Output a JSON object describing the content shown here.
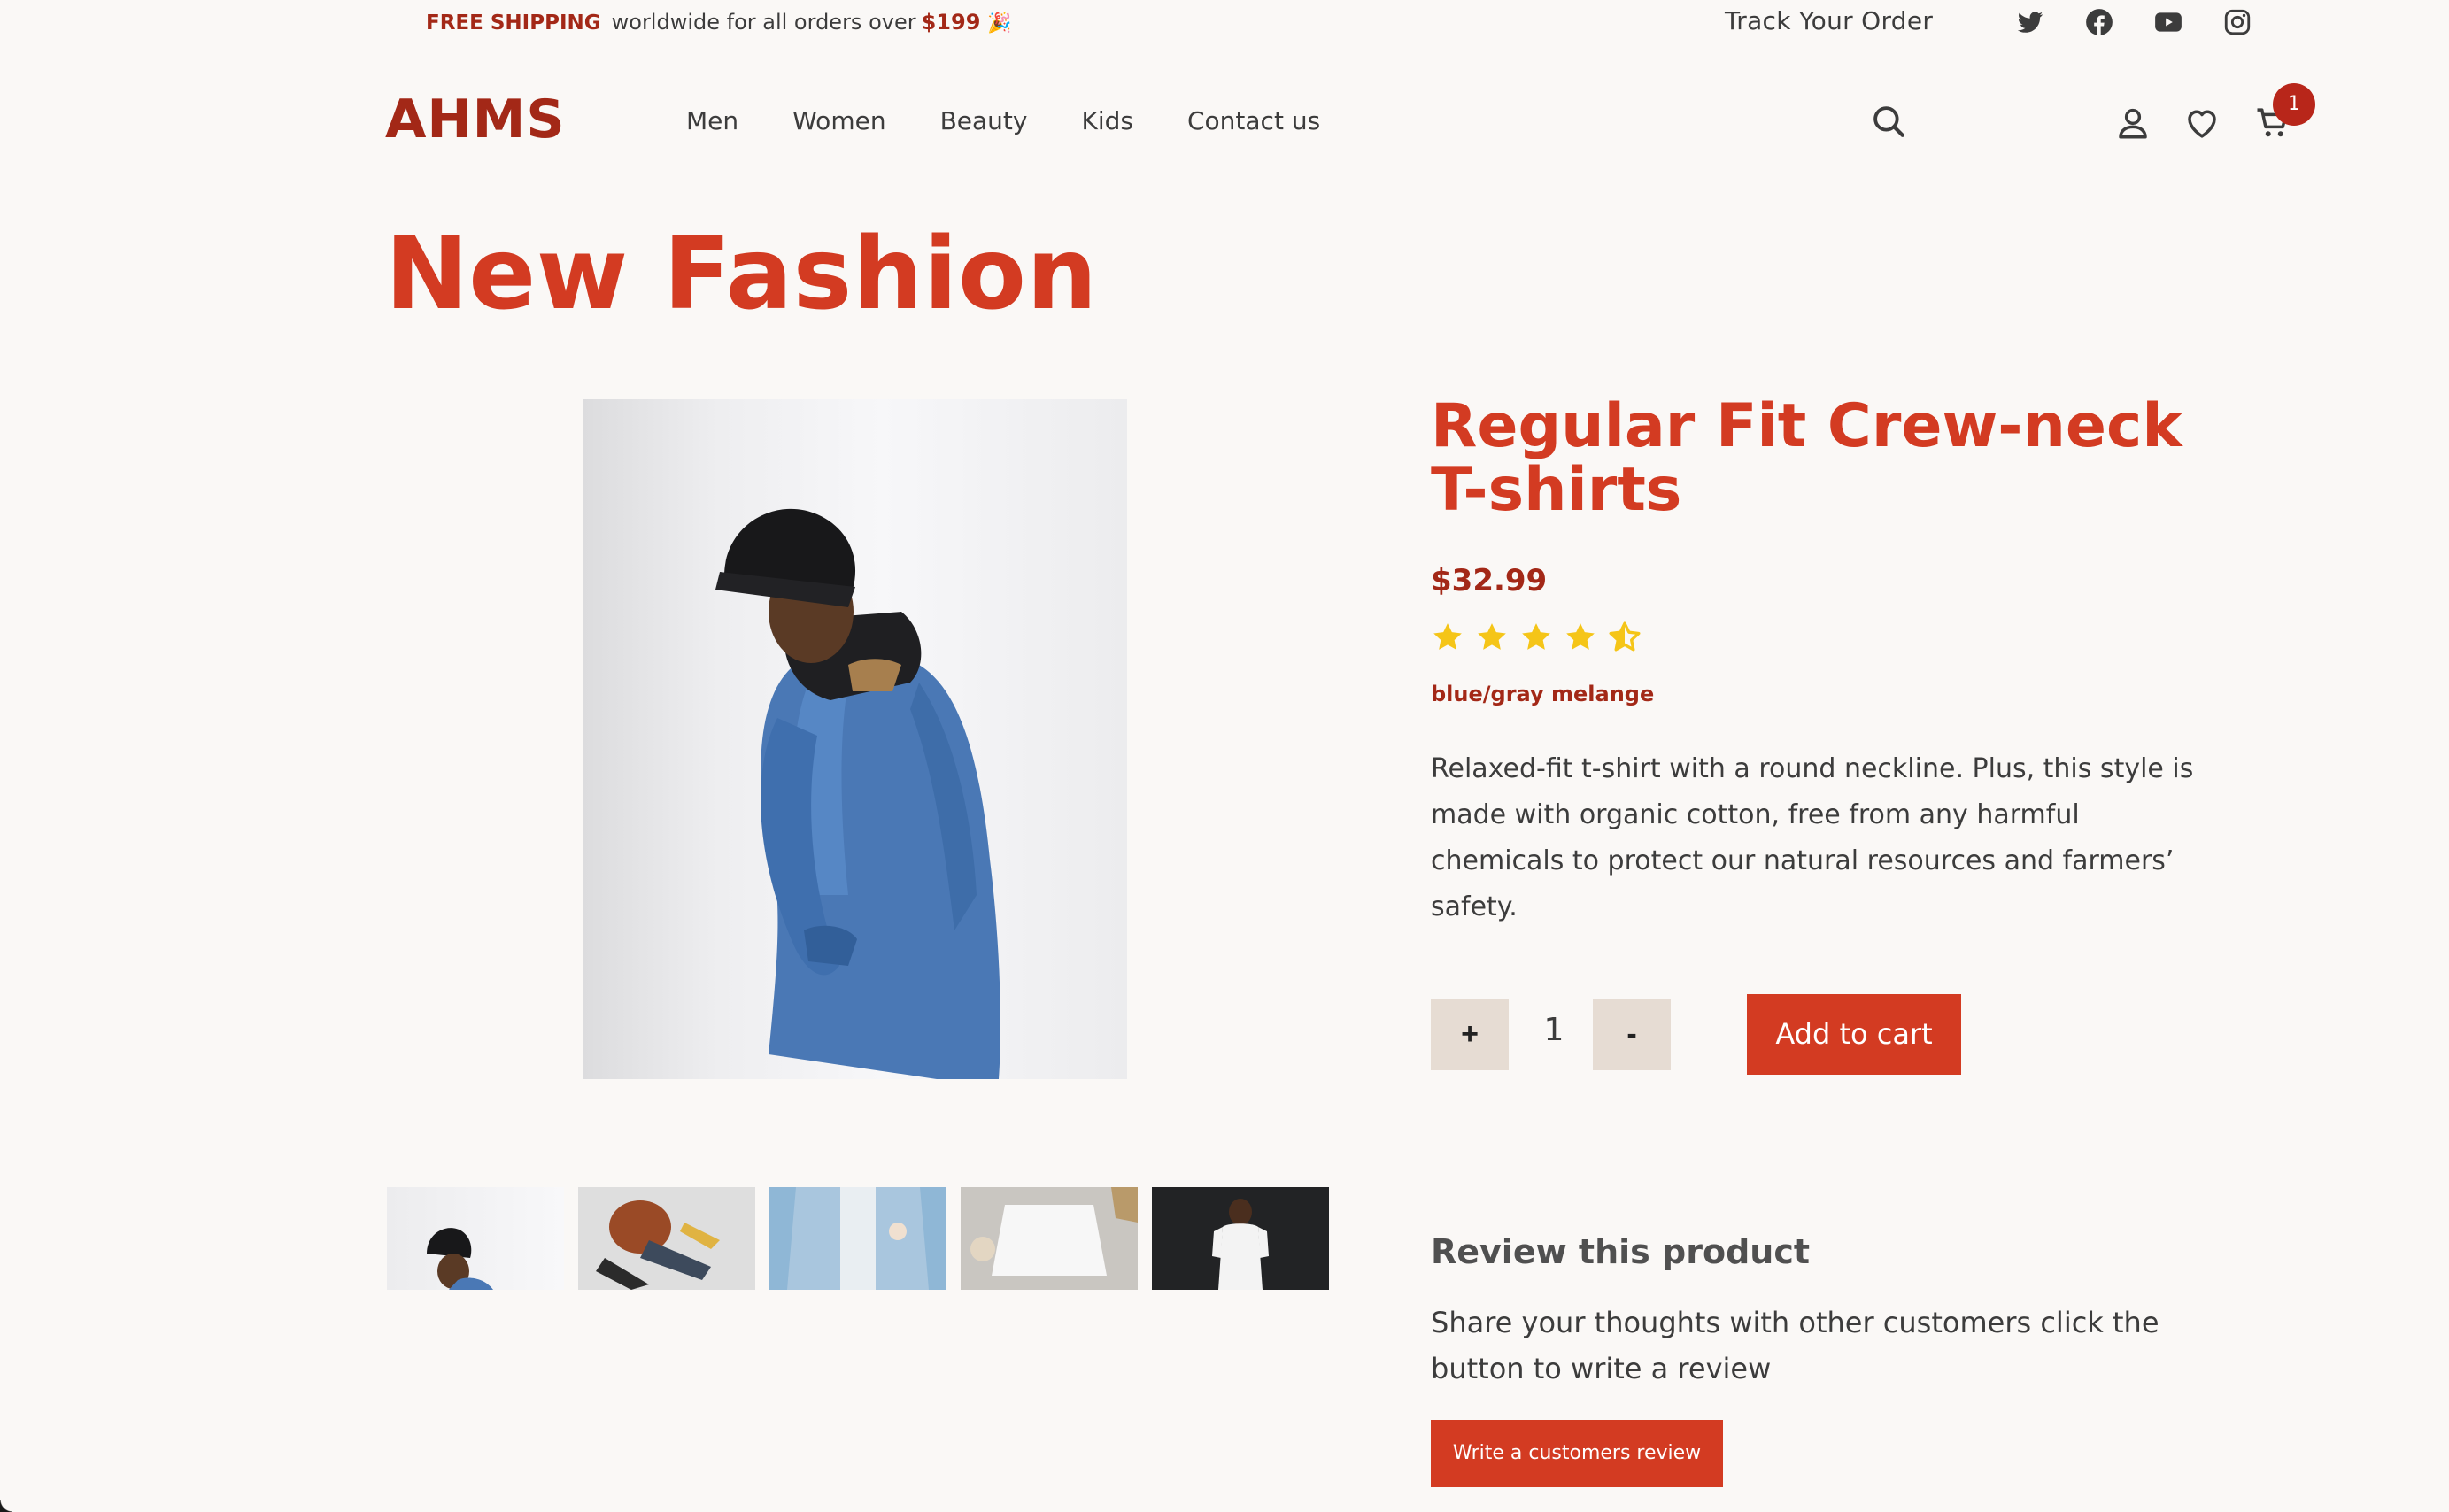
{
  "topbar": {
    "promo_strong": "FREE SHIPPING",
    "promo_text": "worldwide for all orders over",
    "promo_amount": "$199",
    "promo_emoji": "🎉",
    "track_order": "Track Your Order",
    "social_icons": [
      "twitter-icon",
      "facebook-icon",
      "youtube-icon",
      "instagram-icon"
    ]
  },
  "header": {
    "logo": "AHMS",
    "nav": [
      "Men",
      "Women",
      "Beauty",
      "Kids",
      "Contact us"
    ],
    "icons": [
      "search-icon",
      "user-icon",
      "heart-icon",
      "cart-icon"
    ],
    "cart_count": "1"
  },
  "page": {
    "title": "New Fashion"
  },
  "product": {
    "title": "Regular Fit Crew-neck T-shirts",
    "price": "$32.99",
    "rating": 4.5,
    "rating_max": 5,
    "variant": "blue/gray melange",
    "description": "Relaxed-fit t-shirt with a round neckline. Plus, this style is made with organic cotton, free from any harmful chemicals to protect our natural resources and farmers’ safety.",
    "quantity": "1",
    "plus_label": "+",
    "minus_label": "-",
    "add_to_cart": "Add to cart",
    "thumbnail_count": 5
  },
  "review": {
    "title": "Review this product",
    "text": "Share your thoughts with other customers click the button to write a review",
    "button": "Write a customers review"
  },
  "colors": {
    "accent": "#d33b22",
    "dark_accent": "#a32817",
    "background": "#faf8f6",
    "qty_button": "#e6dcd3",
    "star": "#f5c518"
  }
}
